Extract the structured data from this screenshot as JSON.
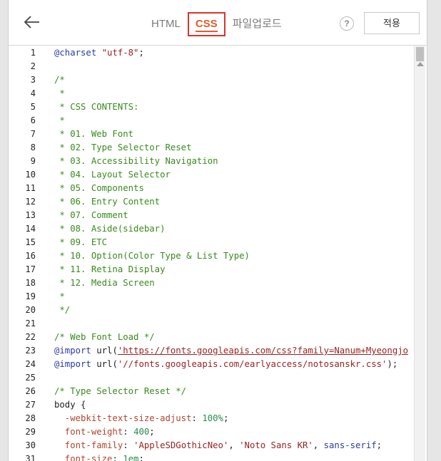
{
  "header": {
    "tabs": [
      {
        "label": "HTML",
        "active": false
      },
      {
        "label": "CSS",
        "active": true
      },
      {
        "label": "파일업로드",
        "active": false
      }
    ],
    "help_label": "?",
    "apply_label": "적용"
  },
  "colors": {
    "accent": "#e65a2a",
    "highlight_box": "#d9332e",
    "comment": "#3a8a1e",
    "at_rule": "#2d3aa3",
    "string": "#9a1f1f"
  },
  "editor": {
    "lines": [
      {
        "num": "1",
        "tokens": [
          {
            "t": "@charset",
            "c": "c-atrule"
          },
          {
            "t": " ",
            "c": "c-text"
          },
          {
            "t": "\"utf-8\"",
            "c": "c-string"
          },
          {
            "t": ";",
            "c": "c-text"
          }
        ]
      },
      {
        "num": "2",
        "tokens": []
      },
      {
        "num": "3",
        "tokens": [
          {
            "t": "/*",
            "c": "c-comment"
          }
        ]
      },
      {
        "num": "4",
        "tokens": [
          {
            "t": " *",
            "c": "c-comment"
          }
        ]
      },
      {
        "num": "5",
        "tokens": [
          {
            "t": " * CSS CONTENTS:",
            "c": "c-comment"
          }
        ]
      },
      {
        "num": "6",
        "tokens": [
          {
            "t": " *",
            "c": "c-comment"
          }
        ]
      },
      {
        "num": "7",
        "tokens": [
          {
            "t": " * 01. Web Font",
            "c": "c-comment"
          }
        ]
      },
      {
        "num": "8",
        "tokens": [
          {
            "t": " * 02. Type Selector Reset",
            "c": "c-comment"
          }
        ]
      },
      {
        "num": "9",
        "tokens": [
          {
            "t": " * 03. Accessibility Navigation",
            "c": "c-comment"
          }
        ]
      },
      {
        "num": "10",
        "tokens": [
          {
            "t": " * 04. Layout Selector",
            "c": "c-comment"
          }
        ]
      },
      {
        "num": "11",
        "tokens": [
          {
            "t": " * 05. Components",
            "c": "c-comment"
          }
        ]
      },
      {
        "num": "12",
        "tokens": [
          {
            "t": " * 06. Entry Content",
            "c": "c-comment"
          }
        ]
      },
      {
        "num": "13",
        "tokens": [
          {
            "t": " * 07. Comment",
            "c": "c-comment"
          }
        ]
      },
      {
        "num": "14",
        "tokens": [
          {
            "t": " * 08. Aside(sidebar)",
            "c": "c-comment"
          }
        ]
      },
      {
        "num": "15",
        "tokens": [
          {
            "t": " * 09. ETC",
            "c": "c-comment"
          }
        ]
      },
      {
        "num": "16",
        "tokens": [
          {
            "t": " * 10. Option(Color Type & List Type)",
            "c": "c-comment"
          }
        ]
      },
      {
        "num": "17",
        "tokens": [
          {
            "t": " * 11. Retina Display",
            "c": "c-comment"
          }
        ]
      },
      {
        "num": "18",
        "tokens": [
          {
            "t": " * 12. Media Screen",
            "c": "c-comment"
          }
        ]
      },
      {
        "num": "19",
        "tokens": [
          {
            "t": " *",
            "c": "c-comment"
          }
        ]
      },
      {
        "num": "20",
        "tokens": [
          {
            "t": " */",
            "c": "c-comment"
          }
        ]
      },
      {
        "num": "21",
        "tokens": []
      },
      {
        "num": "22",
        "tokens": [
          {
            "t": "/* Web Font Load */",
            "c": "c-comment"
          }
        ]
      },
      {
        "num": "23",
        "tokens": [
          {
            "t": "@import",
            "c": "c-atrule"
          },
          {
            "t": " url(",
            "c": "c-text"
          },
          {
            "t": "'https://fonts.googleapis.com/css?family=Nanum+Myeongjo",
            "c": "c-url"
          }
        ]
      },
      {
        "num": "24",
        "tokens": [
          {
            "t": "@import",
            "c": "c-atrule"
          },
          {
            "t": " url(",
            "c": "c-text"
          },
          {
            "t": "'//fonts.googleapis.com/earlyaccess/notosanskr.css'",
            "c": "c-string"
          },
          {
            "t": ");",
            "c": "c-text"
          }
        ]
      },
      {
        "num": "25",
        "tokens": []
      },
      {
        "num": "26",
        "tokens": [
          {
            "t": "/* Type Selector Reset */",
            "c": "c-comment"
          }
        ]
      },
      {
        "num": "27",
        "tokens": [
          {
            "t": "body",
            "c": "c-text"
          },
          {
            "t": " {",
            "c": "c-text"
          }
        ]
      },
      {
        "num": "28",
        "tokens": [
          {
            "t": "  -webkit-text-size-adjust",
            "c": "c-prop"
          },
          {
            "t": ": ",
            "c": "c-text"
          },
          {
            "t": "100%",
            "c": "c-num"
          },
          {
            "t": ";",
            "c": "c-text"
          }
        ]
      },
      {
        "num": "29",
        "tokens": [
          {
            "t": "  font-weight",
            "c": "c-prop"
          },
          {
            "t": ": ",
            "c": "c-text"
          },
          {
            "t": "400",
            "c": "c-num"
          },
          {
            "t": ";",
            "c": "c-text"
          }
        ]
      },
      {
        "num": "30",
        "tokens": [
          {
            "t": "  font-family",
            "c": "c-prop"
          },
          {
            "t": ": ",
            "c": "c-text"
          },
          {
            "t": "'AppleSDGothicNeo'",
            "c": "c-string"
          },
          {
            "t": ", ",
            "c": "c-text"
          },
          {
            "t": "'Noto Sans KR'",
            "c": "c-string"
          },
          {
            "t": ", ",
            "c": "c-text"
          },
          {
            "t": "sans-serif",
            "c": "c-kw"
          },
          {
            "t": ";",
            "c": "c-text"
          }
        ]
      },
      {
        "num": "31",
        "tokens": [
          {
            "t": "  font-size",
            "c": "c-prop"
          },
          {
            "t": ": ",
            "c": "c-text"
          },
          {
            "t": "1em",
            "c": "c-num"
          },
          {
            "t": ";",
            "c": "c-text"
          }
        ]
      }
    ]
  }
}
